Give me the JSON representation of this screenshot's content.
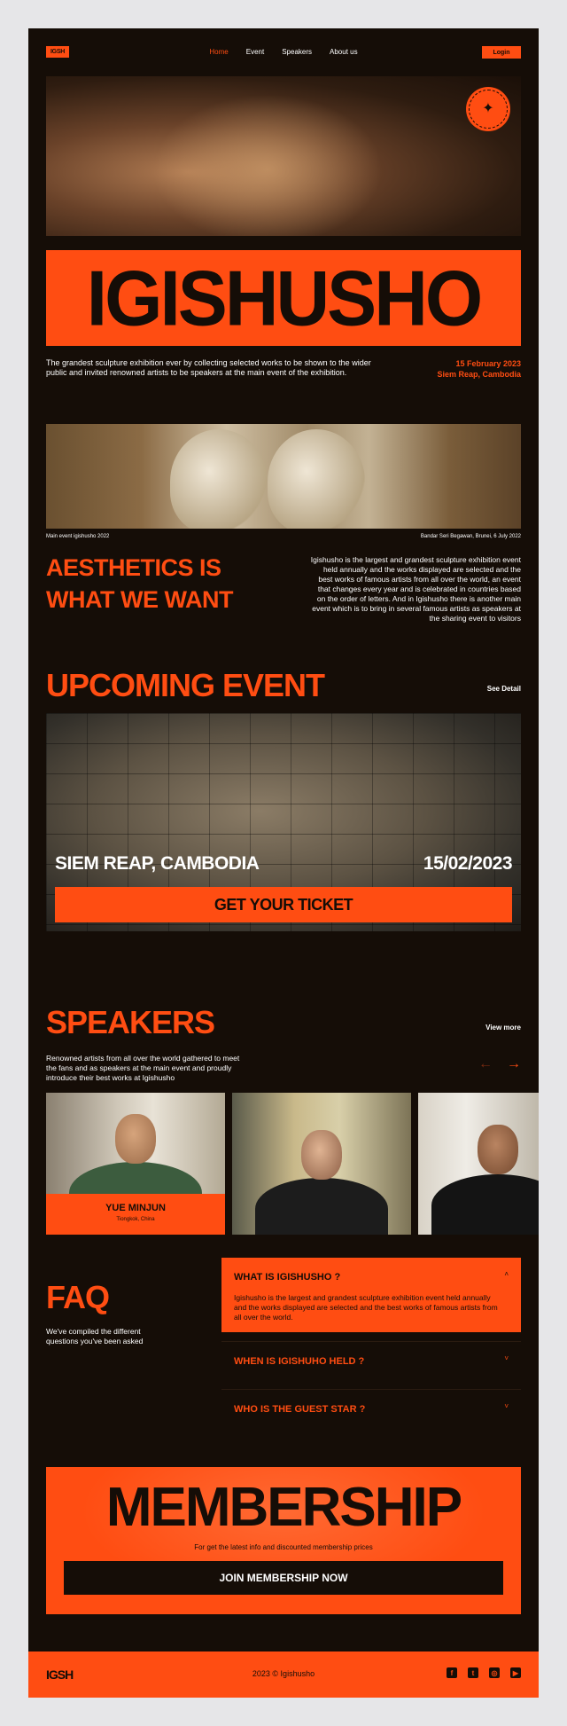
{
  "nav": {
    "logo": "IGSH",
    "items": [
      "Home",
      "Event",
      "Speakers",
      "About us"
    ],
    "login": "Login"
  },
  "hero": {
    "badge_text": "Buy ticket now",
    "title": "IGISHUSHO",
    "description": "The grandest sculpture exhibition ever by collecting selected works to be shown to the wider public and invited renowned artists to be speakers at the main event of the exhibition.",
    "date": "15 February 2023",
    "location": "Siem Reap, Cambodia"
  },
  "aesthetics": {
    "caption_left": "Main event igishusho 2022",
    "caption_right": "Bandar Seri Begawan, Brunei, 6 July 2022",
    "title_line1": "AESTHETICS IS",
    "title_line2": "WHAT WE WANT",
    "text": "Igishusho is the largest and grandest sculpture exhibition event held annually and the works displayed are selected and the best works of famous artists from all over the world, an event that changes every year and is celebrated in countries based on the order of letters. And in Igishusho there is another main event which is to bring in several famous artists as speakers at the sharing event to visitors"
  },
  "upcoming": {
    "title": "UPCOMING EVENT",
    "see_detail": "See Detail",
    "place": "SIEM REAP, CAMBODIA",
    "date": "15/02/2023",
    "ticket_button": "GET YOUR TICKET"
  },
  "speakers": {
    "title": "SPEAKERS",
    "view_more": "View more",
    "description": "Renowned artists from all over the world gathered to meet the fans and as speakers at the main event and proudly introduce their best works at Igishusho",
    "prev_icon": "←",
    "next_icon": "→",
    "featured": {
      "name": "YUE MINJUN",
      "location": "Tiongkok, China"
    }
  },
  "faq": {
    "title": "FAQ",
    "description": "We've compiled the different questions you've been asked",
    "items": [
      {
        "question": "WHAT IS IGISHUSHO ?",
        "answer": "Igishusho is the largest and grandest sculpture exhibition event held annually and the works displayed are selected and the best works of famous artists from all over the world."
      },
      {
        "question": "WHEN IS IGISHUHO HELD ?"
      },
      {
        "question": "WHO IS THE GUEST STAR ?"
      }
    ],
    "chevron_up": "˄",
    "chevron_down": "˅"
  },
  "membership": {
    "title": "MEMBERSHIP",
    "subtitle": "For get the latest info and discounted membership prices",
    "button": "JOIN MEMBERSHIP NOW"
  },
  "footer": {
    "logo": "IGSH",
    "copyright": "2023 © Igishusho",
    "socials": [
      "f",
      "t",
      "◎",
      "▶"
    ]
  },
  "colors": {
    "accent": "#ff4d12",
    "background": "#150d07",
    "outer": "#e6e6e8"
  }
}
